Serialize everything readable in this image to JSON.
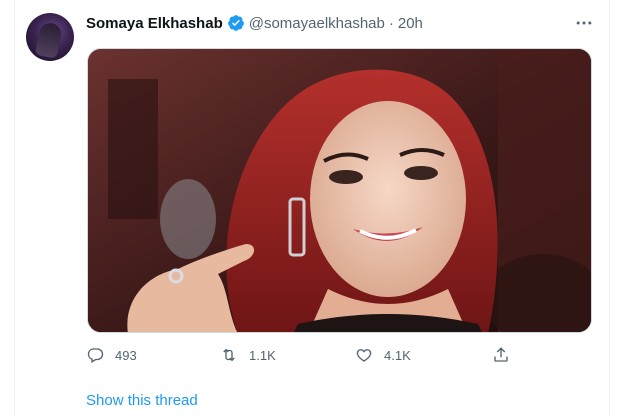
{
  "tweet": {
    "author_name": "Somaya Elkhashab",
    "handle": "@somayaelkhashab",
    "separator": "·",
    "time": "20h",
    "verified": true
  },
  "actions": {
    "reply_count": "493",
    "retweet_count": "1.1K",
    "like_count": "4.1K"
  },
  "thread_link": "Show this thread",
  "icons": [
    "verified-badge-icon",
    "more-icon",
    "reply-icon",
    "retweet-icon",
    "like-icon",
    "share-icon"
  ],
  "colors": {
    "accent": "#1d9bf0",
    "secondary_text": "#536471",
    "primary_text": "#0f1419"
  }
}
